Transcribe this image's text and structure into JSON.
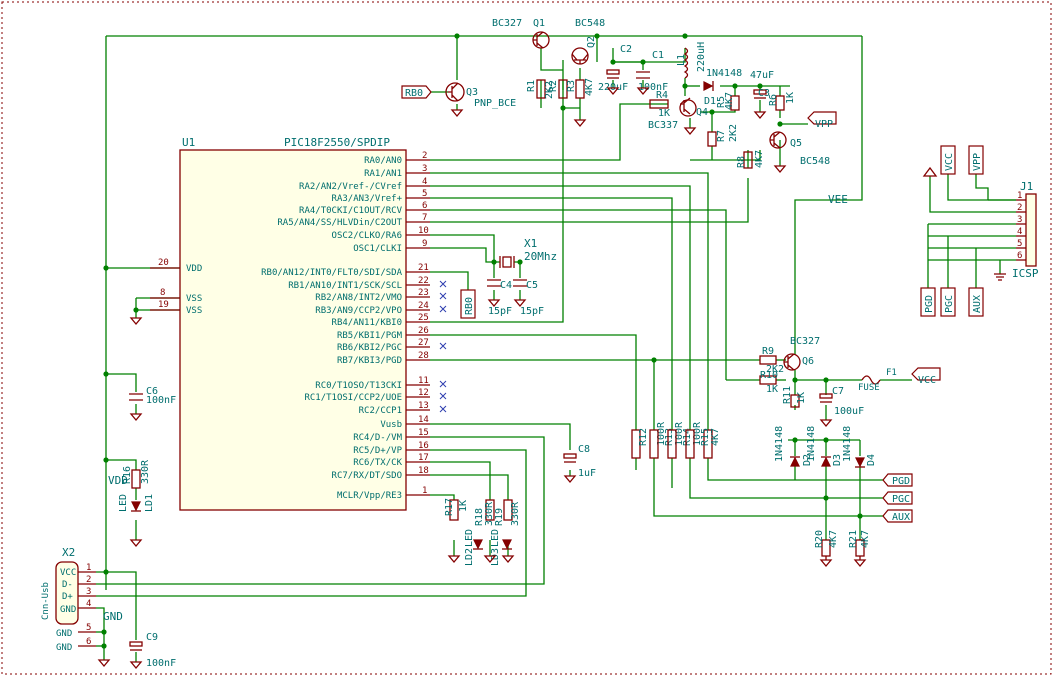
{
  "mcu": {
    "ref": "U1",
    "value": "PIC18F2550/SPDIP",
    "left_pins": [
      {
        "num": "20",
        "name": "VDD"
      },
      {
        "num": "8",
        "name": "VSS"
      },
      {
        "num": "19",
        "name": "VSS"
      }
    ],
    "right_pins": [
      {
        "num": "2",
        "name": "RA0/AN0"
      },
      {
        "num": "3",
        "name": "RA1/AN1"
      },
      {
        "num": "4",
        "name": "RA2/AN2/Vref-/CVref"
      },
      {
        "num": "5",
        "name": "RA3/AN3/Vref+"
      },
      {
        "num": "6",
        "name": "RA4/T0CKI/C1OUT/RCV"
      },
      {
        "num": "7",
        "name": "RA5/AN4/SS/HLVDin/C2OUT"
      },
      {
        "num": "10",
        "name": "OSC2/CLKO/RA6"
      },
      {
        "num": "9",
        "name": "OSC1/CLKI"
      },
      {
        "num": "21",
        "name": "RB0/AN12/INT0/FLT0/SDI/SDA"
      },
      {
        "num": "22",
        "name": "RB1/AN10/INT1/SCK/SCL"
      },
      {
        "num": "23",
        "name": "RB2/AN8/INT2/VMO"
      },
      {
        "num": "24",
        "name": "RB3/AN9/CCP2/VPO"
      },
      {
        "num": "25",
        "name": "RB4/AN11/KBI0"
      },
      {
        "num": "26",
        "name": "RB5/KBI1/PGM"
      },
      {
        "num": "27",
        "name": "RB6/KBI2/PGC"
      },
      {
        "num": "28",
        "name": "RB7/KBI3/PGD"
      },
      {
        "num": "11",
        "name": "RC0/T1OSO/T13CKI"
      },
      {
        "num": "12",
        "name": "RC1/T1OSI/CCP2/UOE"
      },
      {
        "num": "13",
        "name": "RC2/CCP1"
      },
      {
        "num": "14",
        "name": "Vusb"
      },
      {
        "num": "15",
        "name": "RC4/D-/VM"
      },
      {
        "num": "16",
        "name": "RC5/D+/VP"
      },
      {
        "num": "17",
        "name": "RC6/TX/CK"
      },
      {
        "num": "18",
        "name": "RC7/RX/DT/SDO"
      },
      {
        "num": "1",
        "name": "MCLR/Vpp/RE3"
      }
    ]
  },
  "usb": {
    "ref": "X2",
    "value": "Cnn-Usb",
    "pins": [
      {
        "num": "1",
        "name": "VCC"
      },
      {
        "num": "2",
        "name": "D-"
      },
      {
        "num": "3",
        "name": "D+"
      },
      {
        "num": "4",
        "name": "GND"
      },
      {
        "num": "5",
        "name": "GND"
      },
      {
        "num": "6",
        "name": "GND"
      }
    ]
  },
  "icsp": {
    "ref": "J1",
    "value": "ICSP",
    "pins": [
      "1",
      "2",
      "3",
      "4",
      "5",
      "6"
    ]
  },
  "crystal": {
    "ref": "X1",
    "value": "20Mhz"
  },
  "transistors": [
    {
      "ref": "Q1",
      "value": "BC327"
    },
    {
      "ref": "Q2",
      "value": "BC548"
    },
    {
      "ref": "Q3",
      "value": "PNP_BCE"
    },
    {
      "ref": "Q4",
      "value": "BC337"
    },
    {
      "ref": "Q5",
      "value": "BC548"
    },
    {
      "ref": "Q6",
      "value": "BC327"
    }
  ],
  "resistors": [
    {
      "ref": "R1",
      "value": "1K"
    },
    {
      "ref": "R2",
      "value": "2K2"
    },
    {
      "ref": "R3",
      "value": "4K7"
    },
    {
      "ref": "R4",
      "value": "1K"
    },
    {
      "ref": "R5",
      "value": "4K7"
    },
    {
      "ref": "R6",
      "value": "1K"
    },
    {
      "ref": "R7",
      "value": "2K2"
    },
    {
      "ref": "R8",
      "value": "4K7"
    },
    {
      "ref": "R9",
      "value": "2K2"
    },
    {
      "ref": "R10",
      "value": "1K"
    },
    {
      "ref": "R11",
      "value": "1K"
    },
    {
      "ref": "R12",
      "value": "100R"
    },
    {
      "ref": "R13",
      "value": "100R"
    },
    {
      "ref": "R14",
      "value": "100R"
    },
    {
      "ref": "R15",
      "value": "4K7"
    },
    {
      "ref": "R16",
      "value": "330R"
    },
    {
      "ref": "R17",
      "value": "1K"
    },
    {
      "ref": "R18",
      "value": "330R"
    },
    {
      "ref": "R19",
      "value": "330R"
    },
    {
      "ref": "R20",
      "value": "4K7"
    },
    {
      "ref": "R21",
      "value": "4K7"
    }
  ],
  "capacitors": [
    {
      "ref": "C1",
      "value": "100nF"
    },
    {
      "ref": "C2",
      "value": "220uF"
    },
    {
      "ref": "C3",
      "value": "47uF"
    },
    {
      "ref": "C4",
      "value": "15pF"
    },
    {
      "ref": "C5",
      "value": "15pF"
    },
    {
      "ref": "C6",
      "value": "100nF"
    },
    {
      "ref": "C7",
      "value": "100uF"
    },
    {
      "ref": "C8",
      "value": "1uF"
    },
    {
      "ref": "C9",
      "value": "100nF"
    }
  ],
  "inductor": {
    "ref": "L1",
    "value": "220uH"
  },
  "diodes": [
    {
      "ref": "D1",
      "value": "1N4148"
    },
    {
      "ref": "D2",
      "value": "1N4148"
    },
    {
      "ref": "D3",
      "value": "1N4148"
    },
    {
      "ref": "D4",
      "value": "1N4148"
    }
  ],
  "leds": [
    {
      "ref": "LD1",
      "value": "LED"
    },
    {
      "ref": "LD2",
      "value": "LED"
    },
    {
      "ref": "LD3",
      "value": "LED"
    }
  ],
  "fuse": {
    "ref": "F1",
    "value": "FUSE"
  },
  "net_labels": {
    "rb0_top": "RB0",
    "rb0_mid": "RB0",
    "vpp": "VPP",
    "vcc": "VCC",
    "vee": "VEE",
    "pgd": "PGD",
    "pgc": "PGC",
    "aux": "AUX",
    "vdd": "VDD",
    "gnd": "GND"
  },
  "icsp_labels": [
    "VCC",
    "VPP",
    "PGD",
    "PGC",
    "AUX"
  ],
  "colors": {
    "wire": "#008000",
    "component": "#840000",
    "text": "#006e6e",
    "noconnect": "#2f3fb0"
  }
}
